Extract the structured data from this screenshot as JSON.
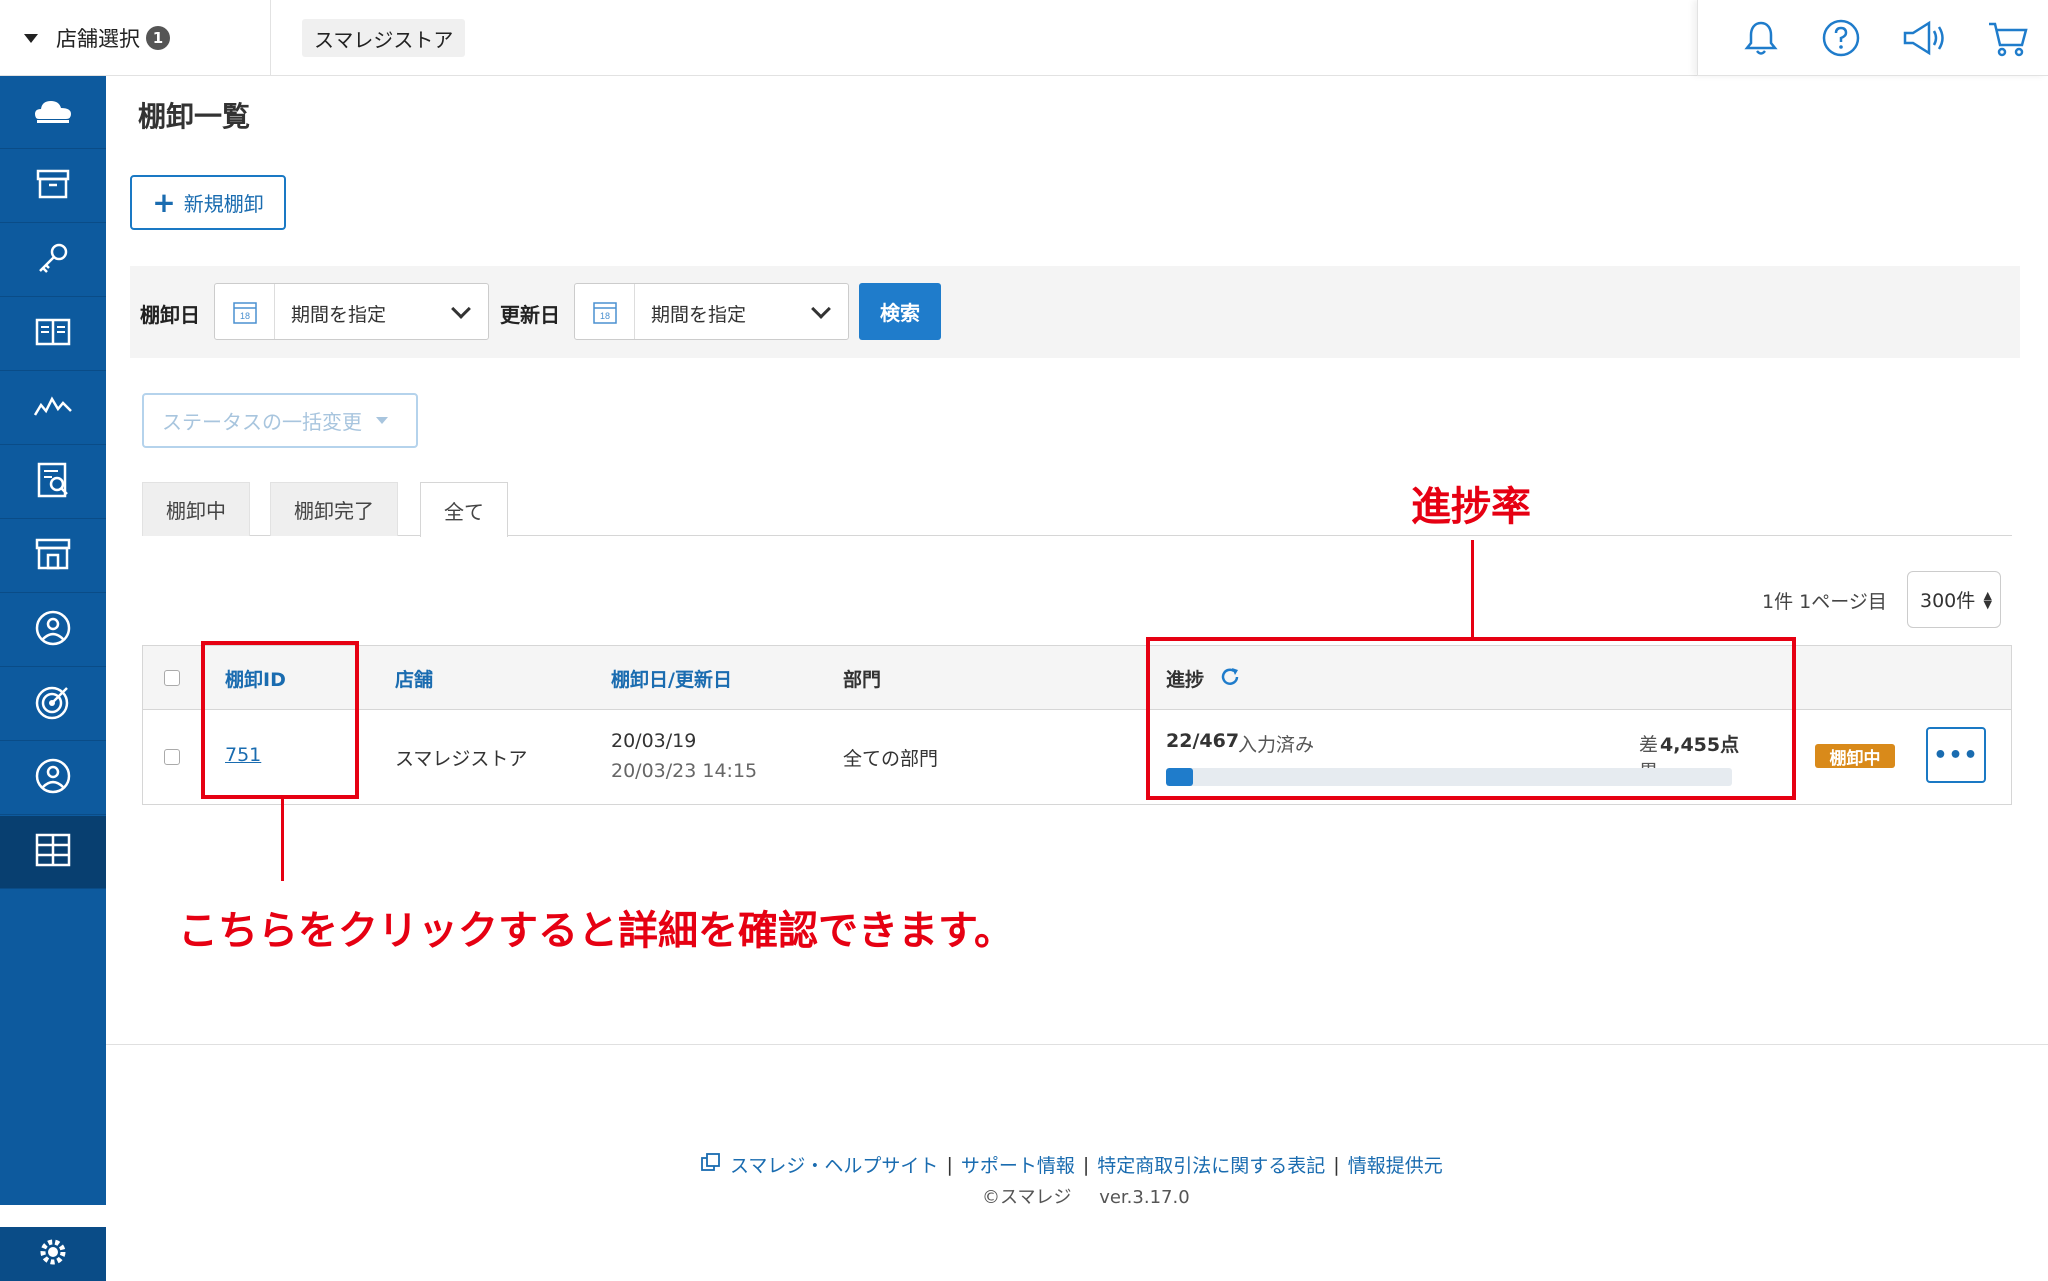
{
  "header": {
    "store_select_label": "店舗選択",
    "store_select_badge": "1",
    "current_store": "スマレジストア",
    "icons": [
      "bell-icon",
      "help-icon",
      "megaphone-icon",
      "cart-icon"
    ]
  },
  "sidebar": {
    "items": [
      "cloud-icon",
      "archive-icon",
      "key-icon",
      "book-icon",
      "chart-icon",
      "report-icon",
      "store-icon",
      "customer-icon",
      "target-icon",
      "user-icon",
      "inventory-icon"
    ],
    "active_item": "inventory-icon",
    "bottom": "gear-icon"
  },
  "page": {
    "title": "棚卸一覧",
    "new_button": "新規棚卸"
  },
  "filters": {
    "inventory_date_label": "棚卸日",
    "inventory_date_value": "期間を指定",
    "update_date_label": "更新日",
    "update_date_value": "期間を指定",
    "calendar_day": "18",
    "search_button": "検索"
  },
  "bulk_status": {
    "placeholder": "ステータスの一括変更"
  },
  "tabs": [
    {
      "label": "棚卸中",
      "active": false
    },
    {
      "label": "棚卸完了",
      "active": false
    },
    {
      "label": "全て",
      "active": true
    }
  ],
  "pagination": {
    "summary": "1件 1ページ目",
    "per_page": "300件"
  },
  "table": {
    "headers": {
      "id": "棚卸ID",
      "store": "店舗",
      "date": "棚卸日/更新日",
      "department": "部門",
      "progress": "進捗"
    },
    "rows": [
      {
        "id": "751",
        "store": "スマレジストア",
        "inventory_date": "20/03/19",
        "updated_at": "20/03/23 14:15",
        "department": "全ての部門",
        "progress_count": "22/467",
        "progress_suffix": "入力済み",
        "diff_label": "差異",
        "diff_value": "4,455点",
        "progress_fraction": 0.047,
        "status": "棚卸中",
        "more": "•••"
      }
    ]
  },
  "annotations": {
    "progress_rate": "進捗率",
    "click_hint": "こちらをクリックすると詳細を確認できます。",
    "color": "#e60012"
  },
  "footer": {
    "links": [
      "スマレジ・ヘルプサイト",
      "サポート情報",
      "特定商取引法に関する表記",
      "情報提供元"
    ],
    "copyright": "©スマレジ",
    "version": "ver.3.17.0"
  },
  "colors": {
    "sidebar": "#0d5a9e",
    "accent": "#1f7ccb",
    "status_tag": "#d98a1a"
  }
}
